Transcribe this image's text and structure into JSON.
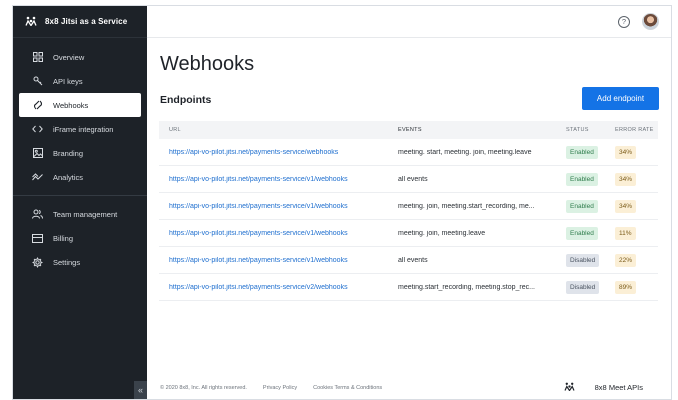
{
  "sidebar": {
    "brand": "8x8 Jitsi as a Service",
    "items": [
      {
        "label": "Overview",
        "icon": "grid-icon"
      },
      {
        "label": "API keys",
        "icon": "key-icon"
      },
      {
        "label": "Webhooks",
        "icon": "webhook-icon",
        "active": true
      },
      {
        "label": "iFrame integration",
        "icon": "code-icon"
      },
      {
        "label": "Branding",
        "icon": "image-icon"
      },
      {
        "label": "Analytics",
        "icon": "analytics-icon"
      },
      {
        "label": "Team management",
        "icon": "team-icon"
      },
      {
        "label": "Billing",
        "icon": "card-icon"
      },
      {
        "label": "Settings",
        "icon": "gear-icon"
      }
    ],
    "collapse_label": "«"
  },
  "header": {
    "help_label": "?"
  },
  "page": {
    "title": "Webhooks",
    "subtitle": "Endpoints",
    "add_button": "Add endpoint"
  },
  "table": {
    "headers": [
      "URL",
      "EVENTS",
      "STATUS",
      "ERROR RATE"
    ],
    "rows": [
      {
        "url": "https://api-vo-pilot.jitsi.net/payments-service/webhooks",
        "events": "meeting. start, meeting. join, meeting.leave",
        "status": "Enabled",
        "rate": "34%"
      },
      {
        "url": "https://api-vo-pilot.jitsi.net/payments-service/v1/webhooks",
        "events": "all events",
        "status": "Enabled",
        "rate": "34%"
      },
      {
        "url": "https://api-vo-pilot.jitsi.net/payments-service/v1/webhooks",
        "events": "meeting. join, meeting.start_recording, me...",
        "status": "Enabled",
        "rate": "34%"
      },
      {
        "url": "https://api-vo-pilot.jitsi.net/payments-service/v1/webhooks",
        "events": "meeting. join, meeting.leave",
        "status": "Enabled",
        "rate": "11%"
      },
      {
        "url": "https://api-vo-pilot.jitsi.net/payments-service/v1/webhooks",
        "events": "all events",
        "status": "Disabled",
        "rate": "22%"
      },
      {
        "url": "https://api-vo-pilot.jitsi.net/payments-service/v2/webhooks",
        "events": "meeting.start_recording, meeting.stop_rec...",
        "status": "Disabled",
        "rate": "89%"
      }
    ]
  },
  "footer": {
    "copyright": "© 2020 8x8, Inc. All rights reserved.",
    "privacy": "Privacy Policy",
    "terms": "Cookies Terms & Conditions",
    "brand": "8x8 Meet APIs"
  },
  "colors": {
    "sidebar_bg": "#1d2228",
    "accent": "#1473e6",
    "link": "#1f6fcf",
    "enabled_bg": "#dbf1e3",
    "disabled_bg": "#dfe3ea",
    "rate_bg": "#fbefd6"
  }
}
